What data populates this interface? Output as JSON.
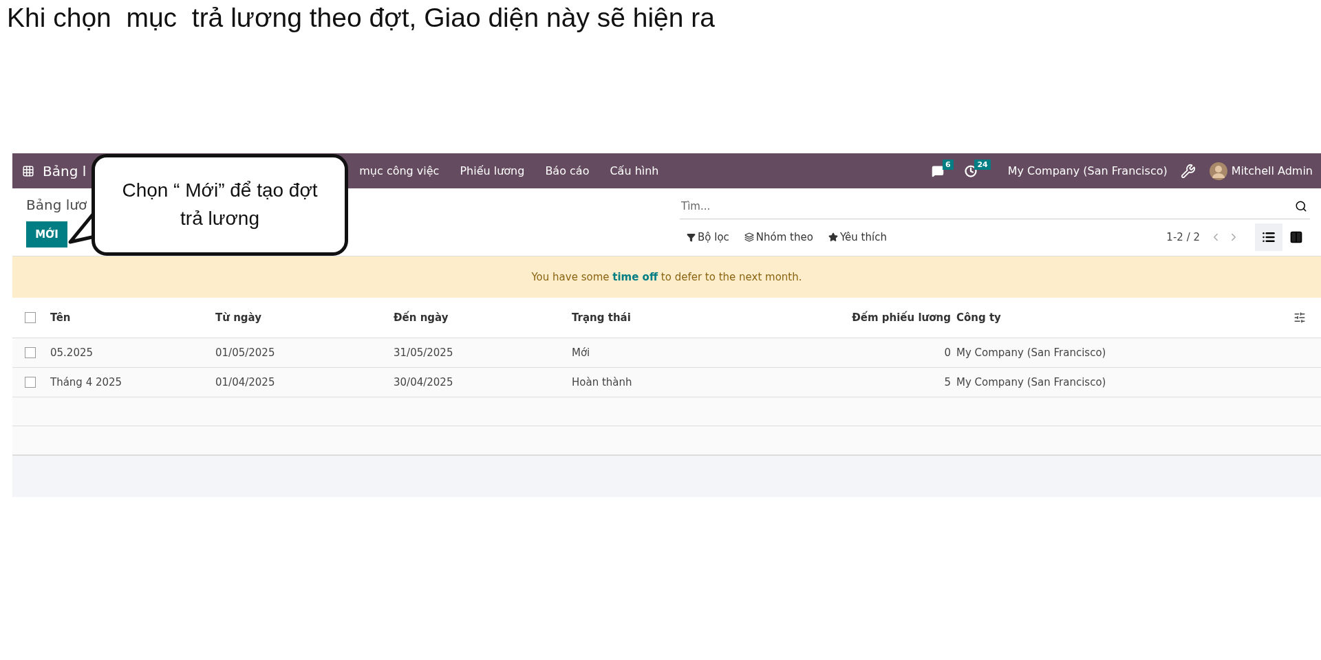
{
  "slide_title": "Khi chọn  mục  trả lương theo đợt, Giao diện này sẽ hiện ra",
  "callout": {
    "lines": [
      "Chọn “ Mới” để tạo đợt",
      "trả lương"
    ]
  },
  "navbar": {
    "app_name": "Bảng l",
    "menu": [
      "mục công việc",
      "Phiếu lương",
      "Báo cáo",
      "Cấu hình"
    ],
    "messages_count": "6",
    "activities_count": "24",
    "company": "My Company (San Francisco)",
    "user": "Mitchell Admin"
  },
  "breadcrumb": "Bảng lươ",
  "new_button": "MỚI",
  "search": {
    "placeholder": "Tìm..."
  },
  "filters": [
    {
      "kind": "filter",
      "label": "Bộ lọc"
    },
    {
      "kind": "group",
      "label": "Nhóm theo"
    },
    {
      "kind": "favorite",
      "label": "Yêu thích"
    }
  ],
  "pager": "1-2 / 2",
  "views": [
    {
      "kind": "list",
      "selected": true
    },
    {
      "kind": "kanban",
      "selected": false
    }
  ],
  "alert": {
    "before": "You have some",
    "link": "time off",
    "after": "to defer to the next month."
  },
  "table": {
    "all_checked": false,
    "columns": [
      "Tên",
      "Từ ngày",
      "Đến ngày",
      "Trạng thái",
      "Đếm phiếu lương",
      "Công ty"
    ],
    "rows": [
      {
        "checked": false,
        "cells": [
          "05.2025",
          "01/05/2025",
          "31/05/2025",
          "Mới",
          "0",
          "My Company (San Francisco)"
        ]
      },
      {
        "checked": false,
        "cells": [
          "Tháng 4 2025",
          "01/04/2025",
          "30/04/2025",
          "Hoàn thành",
          "5",
          "My Company (San Francisco)"
        ]
      }
    ]
  }
}
